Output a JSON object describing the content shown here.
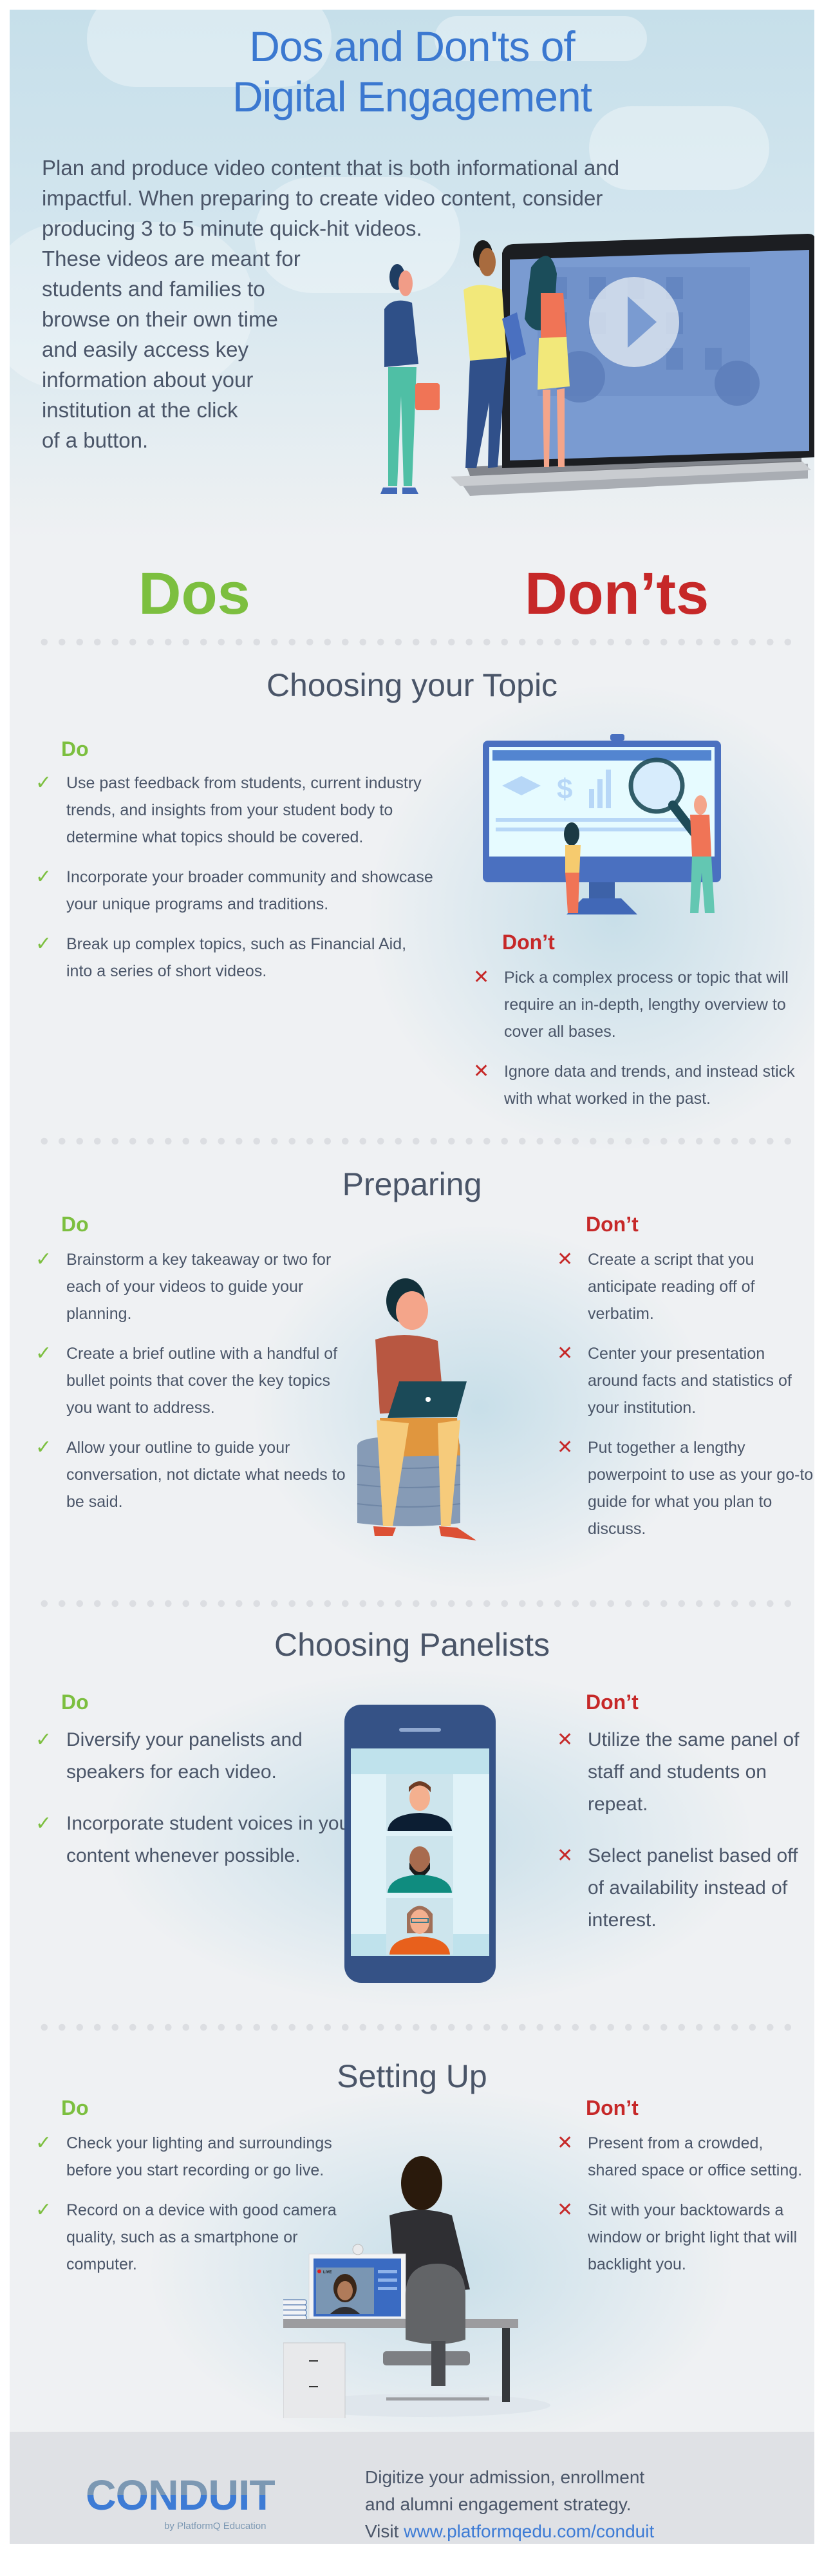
{
  "hero": {
    "title_line1": "Dos and Don'ts of",
    "title_line2": "Digital Engagement",
    "intro_lines": [
      "Plan and produce video content that is both informational and",
      "impactful. When preparing to create video content, consider",
      "producing 3 to 5 minute quick-hit videos.",
      "These videos are meant for",
      "students and families to",
      "browse on their own time",
      "and easily access key",
      "information about your",
      "institution at the click",
      "of a button."
    ]
  },
  "headers": {
    "dos": "Dos",
    "donts": "Don’ts"
  },
  "labels": {
    "do": "Do",
    "dont": "Don’t"
  },
  "sections": [
    {
      "title": "Choosing your Topic",
      "do": [
        "Use past feedback from students, current industry trends, and insights from your student body to determine what topics should be covered.",
        "Incorporate your broader community and showcase your unique programs and traditions.",
        "Break up complex topics, such as Financial Aid, into a series of short videos."
      ],
      "dont": [
        "Pick a complex process or topic that will require an in-depth, lengthy overview to cover all bases.",
        "Ignore data and trends, and instead stick with what worked in the past."
      ]
    },
    {
      "title": "Preparing",
      "do": [
        "Brainstorm a key takeaway or two for each of your videos to guide your planning.",
        "Create a brief outline with a handful of bullet points that cover the key topics you want to address.",
        "Allow your outline to guide your conversation, not dictate what needs to be said."
      ],
      "dont": [
        "Create a script that you anticipate reading off of verbatim.",
        "Center your presentation around facts and statistics of your institution.",
        "Put together a lengthy powerpoint to use as your go-to guide for what you plan to discuss."
      ]
    },
    {
      "title": "Choosing Panelists",
      "do": [
        "Diversify your panelists and speakers for each video.",
        "Incorporate student voices in your content whenever possible."
      ],
      "dont": [
        "Utilize the same panel of staff and students on repeat.",
        "Select panelist based off of availability instead of  interest."
      ]
    },
    {
      "title": "Setting Up",
      "do": [
        "Check your lighting and surroundings before you start recording or go live.",
        "Record on a device with good camera quality, such as a smartphone or computer."
      ],
      "dont": [
        "Present from a crowded, shared space or office setting.",
        "Sit with your backtowards a window or bright light that will backlight you."
      ]
    }
  ],
  "icons": {
    "check": "✓",
    "x": "✕"
  },
  "illustration": {
    "live_badge": "LIVE"
  },
  "footer": {
    "logo": "CONDUIT",
    "logo_sub": "by PlatformQ Education",
    "line1": "Digitize your admission, enrollment",
    "line2": "and alumni engagement strategy.",
    "visit": "Visit ",
    "link": "www.platformqedu.com/conduit"
  },
  "colors": {
    "title_blue": "#3b78d0",
    "do_green": "#7cbf3f",
    "dont_red": "#c62828",
    "text": "#4a5568"
  }
}
